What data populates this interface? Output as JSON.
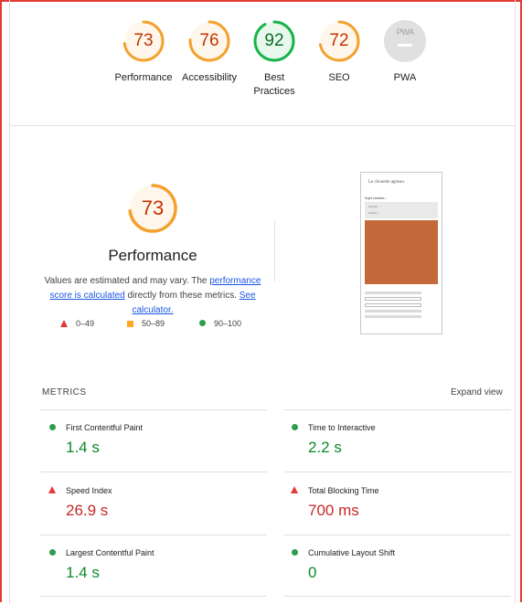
{
  "colors": {
    "frame": "#e53935",
    "average": "#f4a12d",
    "average_text": "#c33300",
    "pass": "#18b34a",
    "pass_text": "#0c6f2a",
    "fail": "#e53935",
    "pwa_gray": "#e0e0e0"
  },
  "gauges": [
    {
      "score": "73",
      "label": "Performance",
      "status": "average"
    },
    {
      "score": "76",
      "label": "Accessibility",
      "status": "average"
    },
    {
      "score": "92",
      "label_line1": "Best",
      "label_line2": "Practices",
      "status": "pass"
    },
    {
      "score": "72",
      "label": "SEO",
      "status": "average"
    },
    {
      "badge": "PWA",
      "label": "PWA",
      "status": "na"
    }
  ],
  "performance": {
    "score": "73",
    "title": "Performance",
    "desc_prefix": "Values are estimated and may vary. The ",
    "desc_link1": "performance score is calculated",
    "desc_middle": " directly from these metrics. ",
    "desc_link2": "See calculator."
  },
  "legend": {
    "fail": "0–49",
    "average": "50–89",
    "pass": "90–100"
  },
  "thumbnail": {
    "heading": "Le chouette agneau",
    "subheading": "Sujet sociales :",
    "item1": "Accueil",
    "item2": "Article 2"
  },
  "metrics": {
    "title": "METRICS",
    "expand_label": "Expand view",
    "items": [
      {
        "name": "First Contentful Paint",
        "value": "1.4 s",
        "status": "pass"
      },
      {
        "name": "Time to Interactive",
        "value": "2.2 s",
        "status": "pass"
      },
      {
        "name": "Speed Index",
        "value": "26.9 s",
        "status": "fail"
      },
      {
        "name": "Total Blocking Time",
        "value": "700 ms",
        "status": "fail"
      },
      {
        "name": "Largest Contentful Paint",
        "value": "1.4 s",
        "status": "pass"
      },
      {
        "name": "Cumulative Layout Shift",
        "value": "0",
        "status": "pass"
      }
    ]
  }
}
